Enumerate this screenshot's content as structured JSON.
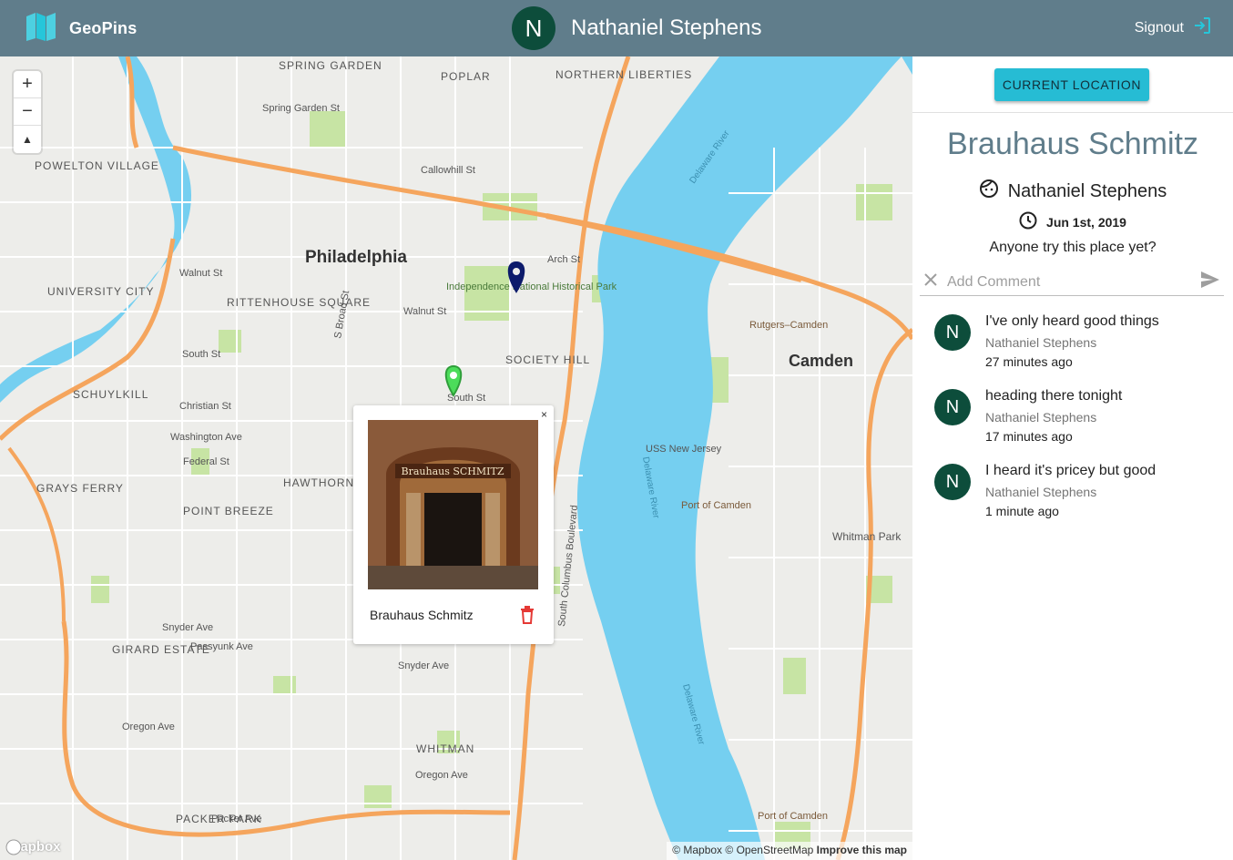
{
  "app": {
    "name": "GeoPins",
    "signout_label": "Signout"
  },
  "current_user": {
    "initial": "N",
    "name": "Nathaniel Stephens"
  },
  "map": {
    "zoom_in": "+",
    "zoom_out": "−",
    "compass": "▲",
    "labels": {
      "philadelphia": "Philadelphia",
      "camden": "Camden",
      "spring_garden": "SPRING GARDEN",
      "poplar": "POPLAR",
      "northern_liberties": "NORTHERN LIBERTIES",
      "powelton_village": "POWELTON VILLAGE",
      "university_city": "UNIVERSITY CITY",
      "rittenhouse_square": "RITTENHOUSE SQUARE",
      "schuylkill": "SCHUYLKILL",
      "society_hill": "SOCIETY HILL",
      "grays_ferry": "GRAYS FERRY",
      "hawthorne": "HAWTHORNE",
      "point_breeze": "POINT BREEZE",
      "girard_estate": "GIRARD ESTATE",
      "whitman": "WHITMAN",
      "packer_park": "PACKER PARK",
      "independence_park": "Independence National Historical Park",
      "delaware_river": "Delaware River",
      "uss_new_jersey": "USS New Jersey",
      "port_of_camden": "Port of Camden",
      "rutgers_camden": "Rutgers–Camden",
      "whitman_park": "Whitman Park",
      "spring_garden_st": "Spring Garden St",
      "callowhill_st": "Callowhill St",
      "walnut_st": "Walnut St",
      "south_st": "South St",
      "christian_st": "Christian St",
      "washington_ave": "Washington Ave",
      "federal_st": "Federal St",
      "snyder_ave": "Snyder Ave",
      "oregon_ave": "Oregon Ave",
      "passyunk_ave": "Passyunk Ave",
      "columbus_blvd": "South Columbus Boulevard",
      "arch_st": "Arch St",
      "broad_st": "S Broad St",
      "packer_ave": "Packer Ave"
    },
    "popup": {
      "close": "×",
      "photo_sign": "Brauhaus SCHMITZ",
      "title": "Brauhaus Schmitz"
    },
    "attribution": {
      "mapbox": "© Mapbox",
      "osm": "© OpenStreetMap",
      "improve": "Improve this map"
    },
    "logo": "mapbox",
    "colors": {
      "water": "#75cff0",
      "highway": "#f5a55d",
      "park": "#c7e4a4",
      "land": "#ededea"
    }
  },
  "panel": {
    "current_location_label": "CURRENT LOCATION",
    "pin": {
      "title": "Brauhaus Schmitz",
      "author": "Nathaniel Stephens",
      "date": "Jun 1st, 2019",
      "content": "Anyone try this place yet?"
    },
    "comment_input": {
      "placeholder": "Add Comment",
      "value": ""
    },
    "comments": [
      {
        "initial": "N",
        "text": "I've only heard good things",
        "author": "Nathaniel Stephens",
        "time": "27 minutes ago"
      },
      {
        "initial": "N",
        "text": "heading there tonight",
        "author": "Nathaniel Stephens",
        "time": "17 minutes ago"
      },
      {
        "initial": "N",
        "text": "I heard it's pricey but good",
        "author": "Nathaniel Stephens",
        "time": "1 minute ago"
      }
    ],
    "colors": {
      "accent": "#26bcd4",
      "title": "#607d8b",
      "avatar": "#0d4d3b"
    }
  }
}
